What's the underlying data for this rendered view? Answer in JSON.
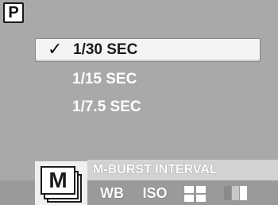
{
  "header": {
    "mode_badge": "P"
  },
  "menu": {
    "items": [
      {
        "label": "1/30 SEC",
        "selected": true
      },
      {
        "label": "1/15 SEC",
        "selected": false
      },
      {
        "label": "1/7.5 SEC",
        "selected": false
      }
    ]
  },
  "bottom_bar": {
    "info_text": "M-BURST INTERVAL",
    "active_tab": {
      "label": "M",
      "icon": "multi-burst-icon"
    },
    "tabs": [
      {
        "label": "WB",
        "icon": "white-balance-icon"
      },
      {
        "label": "ISO",
        "icon": "iso-icon"
      },
      {
        "label": "",
        "icon": "grid-icon"
      },
      {
        "label": "",
        "icon": "contrast-bars-icon"
      }
    ]
  },
  "colors": {
    "background": "#a9a9a9",
    "selected_row": "#f4f4f4",
    "text": "#ffffff",
    "selected_text": "#1a1a1a"
  }
}
